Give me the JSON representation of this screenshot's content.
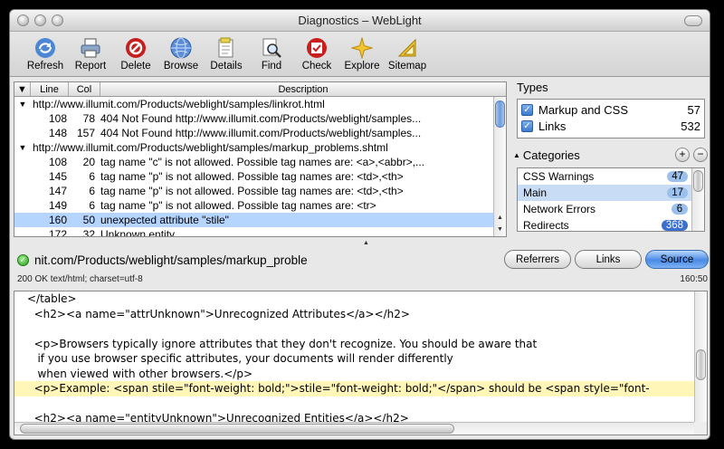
{
  "window": {
    "title": "Diagnostics – WebLight"
  },
  "toolbar": [
    {
      "label": "Refresh",
      "icon": "refresh-icon"
    },
    {
      "label": "Report",
      "icon": "printer-icon"
    },
    {
      "label": "Delete",
      "icon": "delete-icon"
    },
    {
      "label": "Browse",
      "icon": "globe-icon"
    },
    {
      "label": "Details",
      "icon": "details-icon"
    },
    {
      "label": "Find",
      "icon": "find-icon"
    },
    {
      "label": "Check",
      "icon": "check-icon"
    },
    {
      "label": "Explore",
      "icon": "sparkle-icon"
    },
    {
      "label": "Sitemap",
      "icon": "sitemap-icon"
    }
  ],
  "list": {
    "headers": {
      "line": "Line",
      "col": "Col",
      "description": "Description"
    },
    "groups": [
      {
        "url": "http://www.illumit.com/Products/weblight/samples/linkrot.html",
        "rows": [
          {
            "line": "108",
            "col": "78",
            "desc": "404 Not Found http://www.illumit.com/Products/weblight/samples..."
          },
          {
            "line": "148",
            "col": "157",
            "desc": "404 Not Found http://www.illumit.com/Products/weblight/samples..."
          }
        ]
      },
      {
        "url": "http://www.illumit.com/Products/weblight/samples/markup_problems.shtml",
        "rows": [
          {
            "line": "108",
            "col": "20",
            "desc": "tag name \"c\" is not allowed. Possible tag names are: <a>,<abbr>,..."
          },
          {
            "line": "145",
            "col": "6",
            "desc": "tag name \"p\" is not allowed. Possible tag names are: <td>,<th>"
          },
          {
            "line": "147",
            "col": "6",
            "desc": "tag name \"p\" is not allowed. Possible tag names are: <td>,<th>"
          },
          {
            "line": "149",
            "col": "6",
            "desc": "tag name \"p\" is not allowed. Possible tag names are: <tr>"
          },
          {
            "line": "160",
            "col": "50",
            "desc": "unexpected attribute \"stile\"",
            "selected": true
          },
          {
            "line": "172",
            "col": "32",
            "desc": "Unknown entity"
          }
        ]
      }
    ]
  },
  "types": {
    "title": "Types",
    "items": [
      {
        "label": "Markup and CSS",
        "count": "57",
        "checked": true
      },
      {
        "label": "Links",
        "count": "532",
        "checked": true
      }
    ]
  },
  "categories": {
    "title": "Categories",
    "add": "+",
    "remove": "−",
    "items": [
      {
        "label": "CSS Warnings",
        "count": "47"
      },
      {
        "label": "Main",
        "count": "17",
        "selected": true
      },
      {
        "label": "Network Errors",
        "count": "6"
      },
      {
        "label": "Redirects",
        "count": "368",
        "dark": true
      }
    ]
  },
  "urlbar": {
    "url": "nit.com/Products/weblight/samples/markup_proble",
    "buttons": {
      "referrers": "Referrers",
      "links": "Links",
      "source": "Source"
    },
    "status": "200 OK text/html; charset=utf-8",
    "position": "160:50"
  },
  "source": {
    "lines": [
      "</table>",
      "  <h2><a name=\"attrUnknown\">Unrecognized Attributes</a></h2>",
      "",
      "  <p>Browsers typically ignore attributes that they don't recognize. You should be aware that",
      "   if you use browser specific attributes, your documents will render differently",
      "   when viewed with other browsers.</p>",
      "  <p>Example: <span stile=\"font-weight: bold;\">stile=\"font-weight: bold;\"</span> should be <span style=\"font-",
      "",
      "  <h2><a name=\"entityUnknown\">Unrecognized Entities</a></h2>"
    ],
    "highlight_index": 6
  }
}
